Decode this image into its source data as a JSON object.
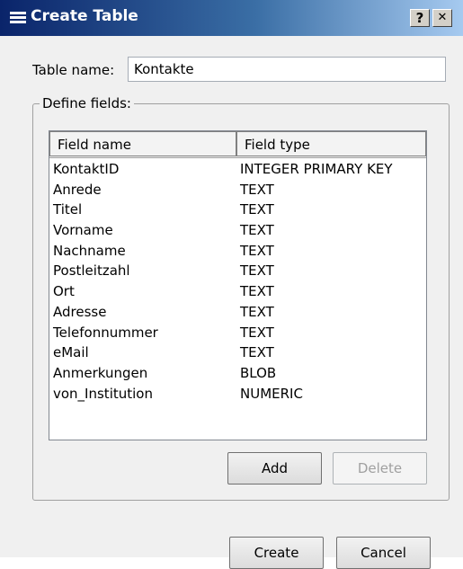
{
  "window": {
    "title": "Create Table",
    "help_label": "?",
    "close_label": "✕"
  },
  "table_name": {
    "label": "Table name:",
    "value": "Kontakte"
  },
  "fields_group": {
    "title": "Define fields:",
    "columns": [
      "Field name",
      "Field type"
    ],
    "rows": [
      {
        "name": "KontaktID",
        "type": "INTEGER PRIMARY KEY"
      },
      {
        "name": "Anrede",
        "type": "TEXT"
      },
      {
        "name": "Titel",
        "type": "TEXT"
      },
      {
        "name": "Vorname",
        "type": "TEXT"
      },
      {
        "name": "Nachname",
        "type": "TEXT"
      },
      {
        "name": "Postleitzahl",
        "type": "TEXT"
      },
      {
        "name": "Ort",
        "type": "TEXT"
      },
      {
        "name": "Adresse",
        "type": "TEXT"
      },
      {
        "name": "Telefonnummer",
        "type": "TEXT"
      },
      {
        "name": "eMail",
        "type": "TEXT"
      },
      {
        "name": "Anmerkungen",
        "type": "BLOB"
      },
      {
        "name": "von_Institution",
        "type": "NUMERIC"
      }
    ],
    "add_label": "Add",
    "delete_label": "Delete"
  },
  "footer": {
    "create_label": "Create",
    "cancel_label": "Cancel"
  }
}
